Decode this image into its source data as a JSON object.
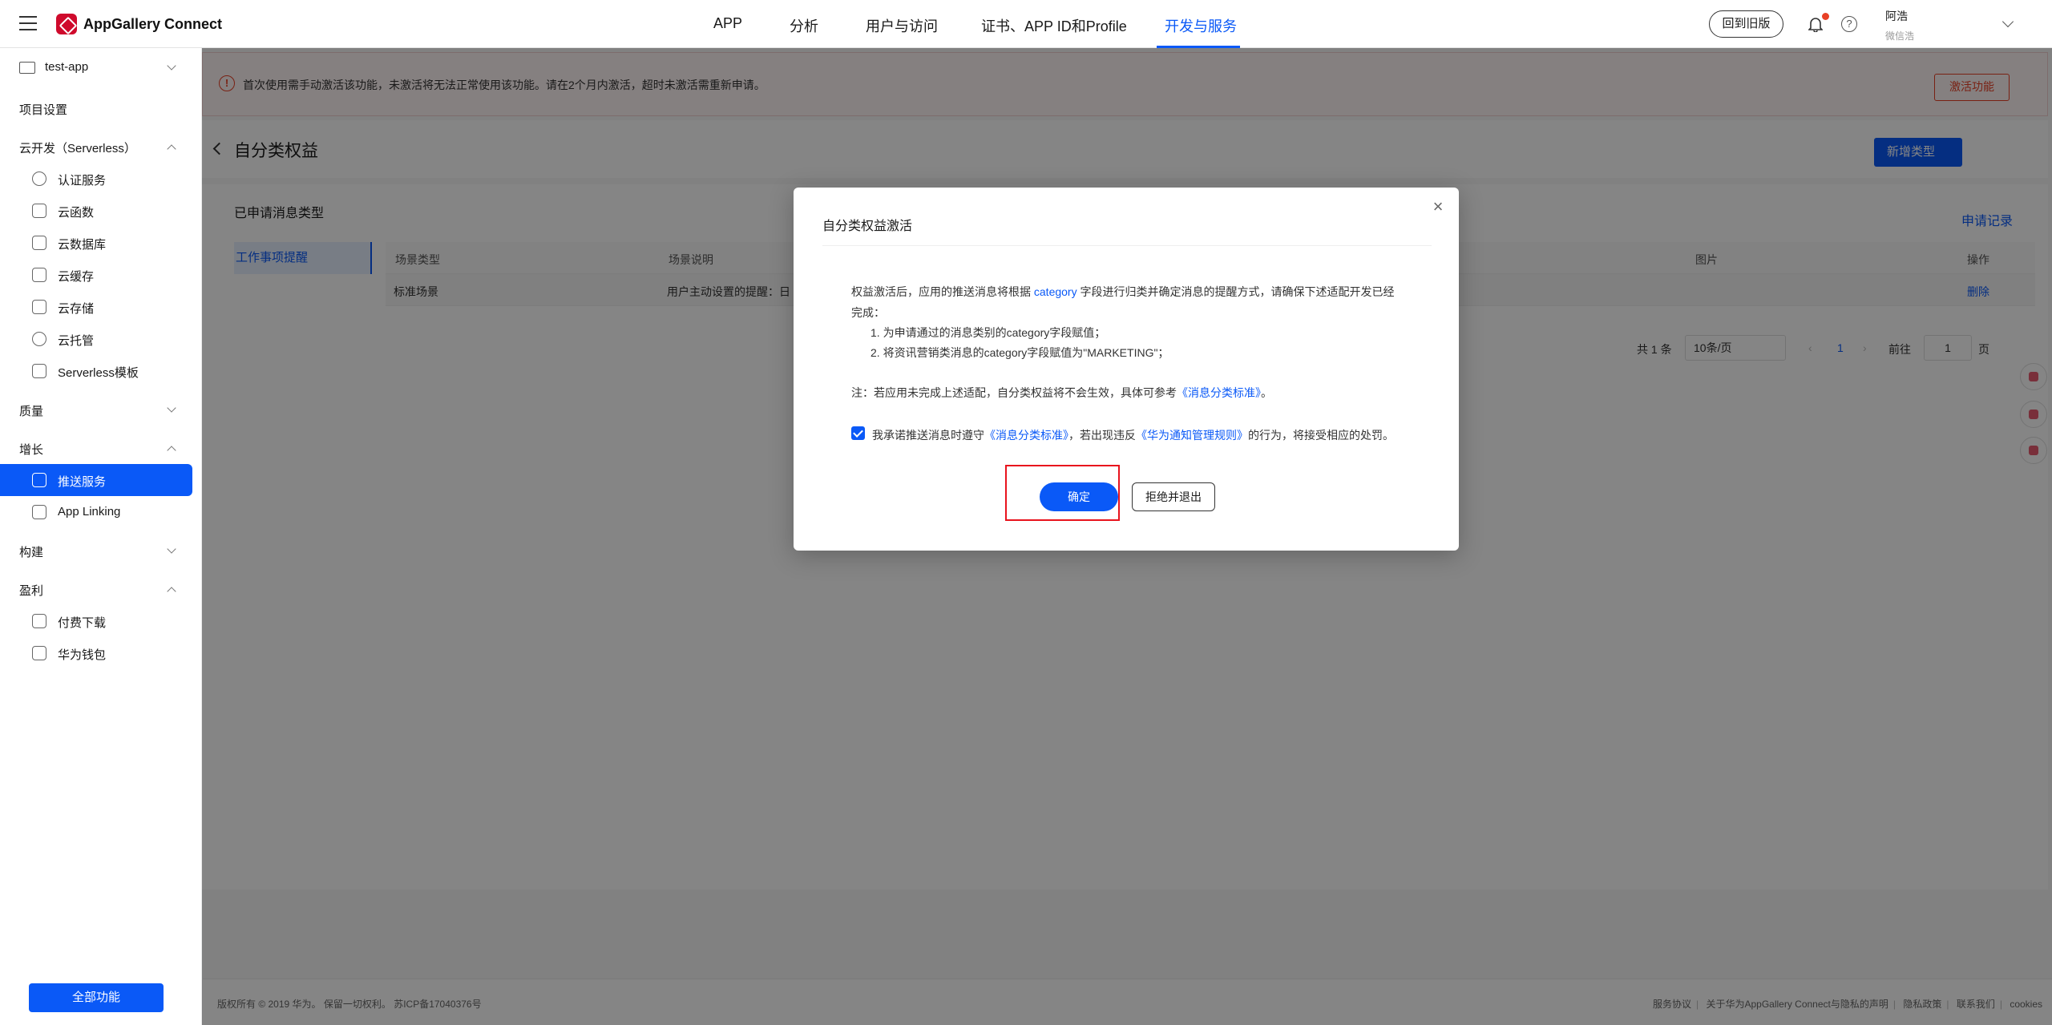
{
  "header": {
    "app_name": "AppGallery Connect",
    "nav": [
      "APP",
      "分析",
      "用户与访问",
      "证书、APP ID和Profile",
      "开发与服务"
    ],
    "active_nav": "开发与服务",
    "old_version_button": "回到旧版",
    "help_symbol": "?",
    "user_name": "阿浩",
    "user_sub": "微信浩"
  },
  "sidebar": {
    "project": "test-app",
    "items": [
      {
        "label": "项目设置"
      },
      {
        "label": "云开发（Serverless）"
      },
      {
        "label": "认证服务"
      },
      {
        "label": "云函数"
      },
      {
        "label": "云数据库"
      },
      {
        "label": "云缓存"
      },
      {
        "label": "云存储"
      },
      {
        "label": "云托管"
      },
      {
        "label": "Serverless模板"
      },
      {
        "label": "质量"
      },
      {
        "label": "增长"
      },
      {
        "label": "推送服务"
      },
      {
        "label": "App Linking"
      },
      {
        "label": "构建"
      },
      {
        "label": "盈利"
      },
      {
        "label": "付费下载"
      },
      {
        "label": "华为钱包"
      }
    ],
    "all_functions_button": "全部功能"
  },
  "notice": {
    "icon_symbol": "!",
    "text": "首次使用需手动激活该功能，未激活将无法正常使用该功能。请在2个月内激活，超时未激活需重新申请。",
    "activate_button": "激活功能"
  },
  "page": {
    "title": "自分类权益",
    "new_type_button": "新增类型",
    "section_title": "已申请消息类型",
    "record_link": "申请记录",
    "left_tab": "工作事项提醒",
    "table": {
      "headers": [
        "场景类型",
        "场景说明",
        "图片",
        "操作"
      ],
      "row": {
        "type": "标准场景",
        "desc": "用户主动设置的提醒：日",
        "action": "删除"
      }
    },
    "pager": {
      "total": "共 1 条",
      "page_size": "10条/页",
      "current_page": "1",
      "goto_label": "前往",
      "goto_value": "1",
      "page_suffix": "页"
    }
  },
  "footer": {
    "copyright": "版权所有 © 2019 华为。 保留一切权利。 苏ICP备17040376号",
    "links": [
      "服务协议",
      "关于华为AppGallery Connect与隐私的声明",
      "隐私政策",
      "联系我们",
      "cookies"
    ]
  },
  "dialog": {
    "title": "自分类权益激活",
    "close_symbol": "×",
    "para1_a": "权益激活后，应用的推送消息将根据",
    "para1_link": "category",
    "para1_b": "字段进行归类并确定消息的提醒方式，请确保下述适配开发已经",
    "para1_c": "完成：",
    "step1": "1. 为申请通过的消息类别的category字段赋值；",
    "step2": "2. 将资讯营销类消息的category字段赋值为\"MARKETING\"；",
    "note_a": "注：若应用未完成上述适配，自分类权益将不会生效，具体可参考",
    "note_link": "《消息分类标准》",
    "note_b": "。",
    "agree_a": "我承诺推送消息时遵守",
    "agree_link1": "《消息分类标准》",
    "agree_b": "，若出现违反",
    "agree_link2": "《华为通知管理规则》",
    "agree_c": "的行为，将接受相应的处罚。",
    "agree_checked": true,
    "confirm_button": "确定",
    "reject_button": "拒绝并退出"
  }
}
